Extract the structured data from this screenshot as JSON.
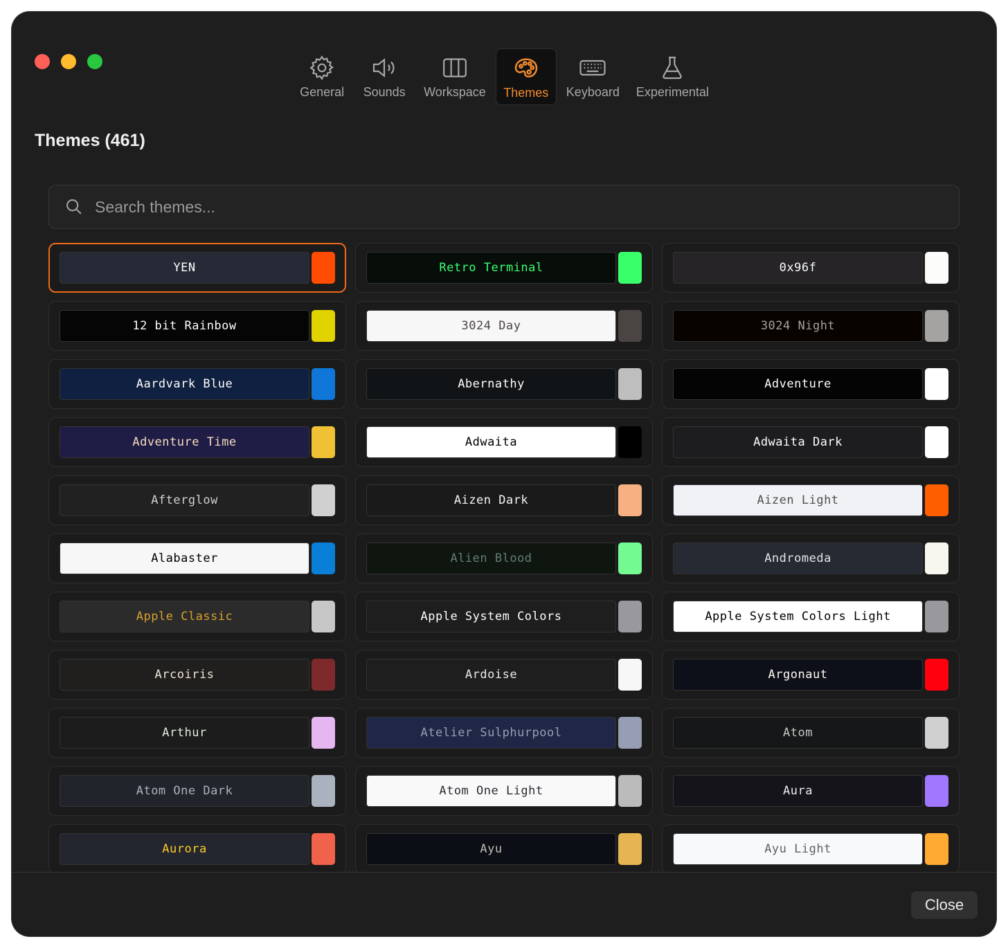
{
  "tabs": [
    {
      "label": "General",
      "icon": "gear-icon",
      "active": false
    },
    {
      "label": "Sounds",
      "icon": "speaker-icon",
      "active": false
    },
    {
      "label": "Workspace",
      "icon": "columns-icon",
      "active": false
    },
    {
      "label": "Themes",
      "icon": "palette-icon",
      "active": true
    },
    {
      "label": "Keyboard",
      "icon": "keyboard-icon",
      "active": false
    },
    {
      "label": "Experimental",
      "icon": "flask-icon",
      "active": false
    }
  ],
  "page_title": "Themes (461)",
  "search": {
    "placeholder": "Search themes...",
    "value": ""
  },
  "accent_color": "#f28a2e",
  "themes": [
    {
      "name": "YEN",
      "bg": "#262a36",
      "fg": "#ffffff",
      "swatch": "#ff4c00",
      "selected": true
    },
    {
      "name": "Retro Terminal",
      "bg": "#070d08",
      "fg": "#3dff75",
      "swatch": "#39ff6b"
    },
    {
      "name": "0x96f",
      "bg": "#262427",
      "fg": "#fcfcfc",
      "swatch": "#fcfcfa"
    },
    {
      "name": "12 bit Rainbow",
      "bg": "#050505",
      "fg": "#ffffff",
      "swatch": "#e0d300"
    },
    {
      "name": "3024 Day",
      "bg": "#f7f7f7",
      "fg": "#4a4543",
      "swatch": "#4a4543"
    },
    {
      "name": "3024 Night",
      "bg": "#090300",
      "fg": "#a5a2a2",
      "swatch": "#a5a2a2"
    },
    {
      "name": "Aardvark Blue",
      "bg": "#102040",
      "fg": "#ffffff",
      "swatch": "#1076d8"
    },
    {
      "name": "Abernathy",
      "bg": "#111416",
      "fg": "#ffffff",
      "swatch": "#bebebe"
    },
    {
      "name": "Adventure",
      "bg": "#040404",
      "fg": "#ffffff",
      "swatch": "#ffffff"
    },
    {
      "name": "Adventure Time",
      "bg": "#1f1d45",
      "fg": "#f8dcc0",
      "swatch": "#f0c135"
    },
    {
      "name": "Adwaita",
      "bg": "#ffffff",
      "fg": "#000000",
      "swatch": "#000000"
    },
    {
      "name": "Adwaita Dark",
      "bg": "#1d1d20",
      "fg": "#ffffff",
      "swatch": "#ffffff"
    },
    {
      "name": "Afterglow",
      "bg": "#212121",
      "fg": "#d0d0d0",
      "swatch": "#d0d0d0"
    },
    {
      "name": "Aizen Dark",
      "bg": "#1a1a1a",
      "fg": "#f5f5f5",
      "swatch": "#f6b082"
    },
    {
      "name": "Aizen Light",
      "bg": "#f0f2f6",
      "fg": "#505050",
      "swatch": "#ff5e00"
    },
    {
      "name": "Alabaster",
      "bg": "#f7f7f7",
      "fg": "#000000",
      "swatch": "#0a7fd7"
    },
    {
      "name": "Alien Blood",
      "bg": "#0f1610",
      "fg": "#637d75",
      "swatch": "#73fa91"
    },
    {
      "name": "Andromeda",
      "bg": "#262a33",
      "fg": "#e5e5e5",
      "swatch": "#f7f7f0"
    },
    {
      "name": "Apple Classic",
      "bg": "#2c2b2b",
      "fg": "#d6a12f",
      "swatch": "#c7c7c7"
    },
    {
      "name": "Apple System Colors",
      "bg": "#1e1e1e",
      "fg": "#ffffff",
      "swatch": "#98989d"
    },
    {
      "name": "Apple System Colors Light",
      "bg": "#ffffff",
      "fg": "#000000",
      "swatch": "#98989d"
    },
    {
      "name": "Arcoiris",
      "bg": "#201f1e",
      "fg": "#eee4d9",
      "swatch": "#7e2a2c"
    },
    {
      "name": "Ardoise",
      "bg": "#1e1e1e",
      "fg": "#eaeaea",
      "swatch": "#f7f7f7"
    },
    {
      "name": "Argonaut",
      "bg": "#0e1019",
      "fg": "#fffaf4",
      "swatch": "#ff000f"
    },
    {
      "name": "Arthur",
      "bg": "#1c1c1c",
      "fg": "#ddeedd",
      "swatch": "#e5b6ef"
    },
    {
      "name": "Atelier Sulphurpool",
      "bg": "#202746",
      "fg": "#979db4",
      "swatch": "#979db4"
    },
    {
      "name": "Atom",
      "bg": "#161719",
      "fg": "#c5c8c6",
      "swatch": "#d0d0d0"
    },
    {
      "name": "Atom One Dark",
      "bg": "#21252b",
      "fg": "#abb2bf",
      "swatch": "#abb2bf"
    },
    {
      "name": "Atom One Light",
      "bg": "#f9f9f9",
      "fg": "#2a2c33",
      "swatch": "#bbbbbb"
    },
    {
      "name": "Aura",
      "bg": "#15141b",
      "fg": "#edecee",
      "swatch": "#a277ff"
    },
    {
      "name": "Aurora",
      "bg": "#23262e",
      "fg": "#ffca28",
      "swatch": "#f0624b"
    },
    {
      "name": "Ayu",
      "bg": "#0b0e14",
      "fg": "#bfbdb6",
      "swatch": "#e6b450"
    },
    {
      "name": "Ayu Light",
      "bg": "#f8f9fa",
      "fg": "#5c6166",
      "swatch": "#ffaa33"
    }
  ],
  "footer": {
    "close_label": "Close"
  }
}
